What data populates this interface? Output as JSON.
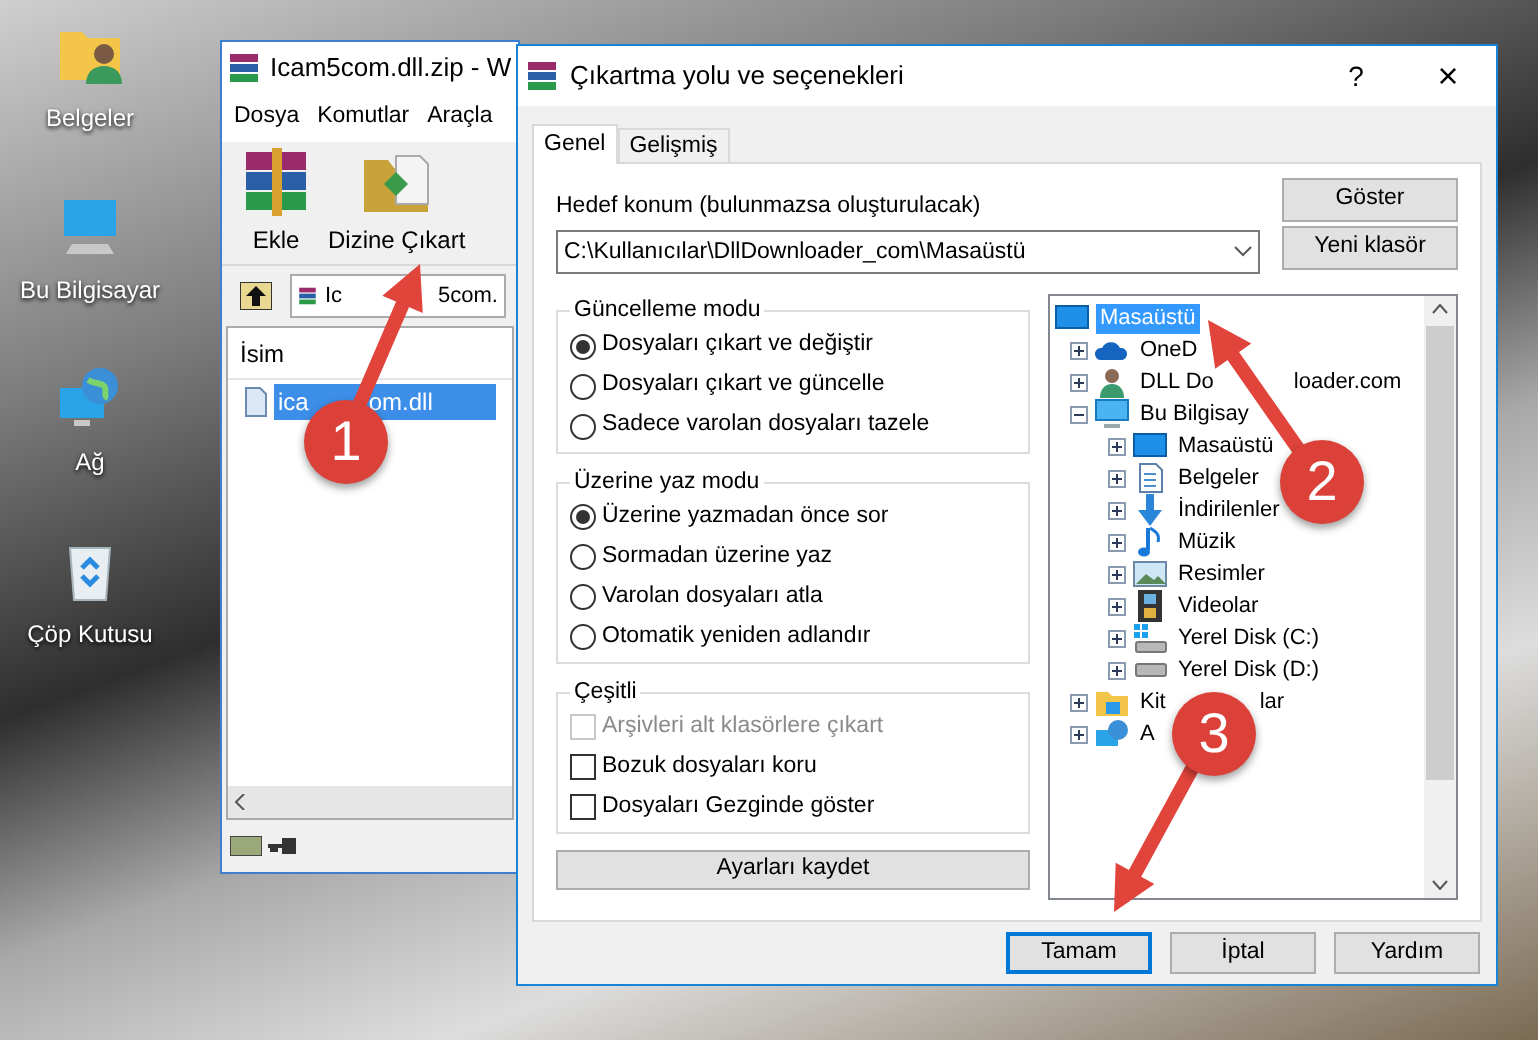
{
  "desktop_icons": [
    {
      "label": "Belgeler",
      "kind": "documents"
    },
    {
      "label": "Bu Bilgisayar",
      "kind": "computer"
    },
    {
      "label": "Ağ",
      "kind": "network"
    },
    {
      "label": "Çöp Kutusu",
      "kind": "recycle"
    }
  ],
  "archiver_window": {
    "title": "Icam5com.dll.zip - W",
    "menu": [
      "Dosya",
      "Komutlar",
      "Araçla"
    ],
    "toolbar": [
      {
        "label": "Ekle",
        "kind": "add"
      },
      {
        "label": "Dizine Çıkart",
        "kind": "extract"
      }
    ],
    "address": "Ic",
    "address_after": "5com.",
    "column": "İsim",
    "files": [
      {
        "name": "ica",
        "name_after": "om.dll",
        "selected": true
      }
    ]
  },
  "dialog": {
    "title": "Çıkartma yolu ve seçenekleri",
    "help": "?",
    "close": "×",
    "tabs": [
      {
        "label": "Genel",
        "selected": true
      },
      {
        "label": "Gelişmiş",
        "selected": false
      }
    ],
    "destination_label": "Hedef konum (bulunmazsa oluşturulacak)",
    "destination": "C:\\Kullanıcılar\\DllDownloader_com\\Masaüstü",
    "side_buttons": [
      "Göster",
      "Yeni klasör"
    ],
    "radio_groups": [
      {
        "title": "Güncelleme modu",
        "options": [
          {
            "label": "Dosyaları çıkart ve değiştir",
            "selected": true
          },
          {
            "label": "Dosyaları çıkart ve güncelle",
            "selected": false
          },
          {
            "label": "Sadece varolan dosyaları tazele",
            "selected": false
          }
        ]
      },
      {
        "title": "Üzerine yaz modu",
        "options": [
          {
            "label": "Üzerine yazmadan önce sor",
            "selected": true
          },
          {
            "label": "Sormadan üzerine yaz",
            "selected": false
          },
          {
            "label": "Varolan dosyaları atla",
            "selected": false
          },
          {
            "label": "Otomatik yeniden adlandır",
            "selected": false
          }
        ]
      }
    ],
    "misc": {
      "title": "Çeşitli",
      "options": [
        {
          "label": "Arşivleri alt klasörlere çıkart",
          "checked": false,
          "disabled": true
        },
        {
          "label": "Bozuk dosyaları koru",
          "checked": false,
          "disabled": false
        },
        {
          "label": "Dosyaları Gezginde göster",
          "checked": false,
          "disabled": false
        }
      ]
    },
    "save_button": "Ayarları kaydet",
    "tree": [
      {
        "label": "Masaüstü",
        "kind": "desktop",
        "selected": true,
        "children": [
          {
            "label": "OneD",
            "kind": "cloud",
            "selected": false,
            "expanded": false
          },
          {
            "label": "DLL Do",
            "label_after": "loader.com",
            "kind": "user",
            "selected": false,
            "expanded": false
          },
          {
            "label": "Bu Bilgisay",
            "kind": "computer",
            "selected": false,
            "expanded": true,
            "children": [
              {
                "label": "Masaüstü",
                "kind": "desktop",
                "selected": false,
                "expanded": false
              },
              {
                "label": "Belgeler",
                "kind": "document",
                "selected": false,
                "expanded": false
              },
              {
                "label": "İndirilenler",
                "kind": "download",
                "selected": false,
                "expanded": false
              },
              {
                "label": "Müzik",
                "kind": "music",
                "selected": false,
                "expanded": false
              },
              {
                "label": "Resimler",
                "kind": "picture",
                "selected": false,
                "expanded": false
              },
              {
                "label": "Videolar",
                "kind": "video",
                "selected": false,
                "expanded": false
              },
              {
                "label": "Yerel Disk (C:)",
                "kind": "system-drive",
                "selected": false,
                "expanded": false
              },
              {
                "label": "Yerel Disk (D:)",
                "kind": "drive",
                "selected": false,
                "expanded": false
              }
            ]
          },
          {
            "label": "Kit",
            "label_after": "lar",
            "kind": "library",
            "selected": false,
            "expanded": false
          },
          {
            "label": "A",
            "kind": "network",
            "selected": false,
            "expanded": false
          }
        ]
      }
    ],
    "buttons": [
      {
        "label": "Tamam",
        "default": true
      },
      {
        "label": "İptal",
        "default": false
      },
      {
        "label": "Yardım",
        "default": false
      }
    ]
  },
  "annotations": [
    {
      "label": "1"
    },
    {
      "label": "2"
    },
    {
      "label": "3"
    }
  ]
}
